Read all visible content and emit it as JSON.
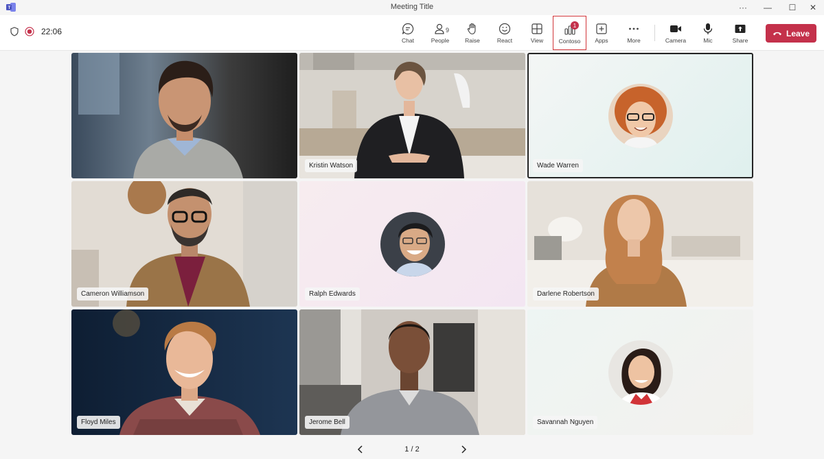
{
  "window": {
    "title": "Meeting Title",
    "more": "···",
    "minimize": "—",
    "maximize": "☐",
    "close": "✕"
  },
  "status": {
    "timer": "22:06"
  },
  "toolbar": {
    "chat": "Chat",
    "people": "People",
    "people_count": "9",
    "raise": "Raise",
    "react": "React",
    "view": "View",
    "contoso": "Contoso",
    "contoso_badge": "1",
    "apps": "Apps",
    "more": "More",
    "camera": "Camera",
    "mic": "Mic",
    "share": "Share",
    "leave": "Leave"
  },
  "participants": [
    {
      "name": ""
    },
    {
      "name": "Kristin Watson"
    },
    {
      "name": "Wade Warren"
    },
    {
      "name": "Cameron Williamson"
    },
    {
      "name": "Ralph Edwards"
    },
    {
      "name": "Darlene Robertson"
    },
    {
      "name": "Floyd Miles"
    },
    {
      "name": "Jerome Bell"
    },
    {
      "name": "Savannah Nguyen"
    }
  ],
  "pagination": {
    "label": "1 / 2"
  },
  "colors": {
    "leave": "#c4314b",
    "highlight": "#d13438",
    "badge": "#c4314b"
  }
}
